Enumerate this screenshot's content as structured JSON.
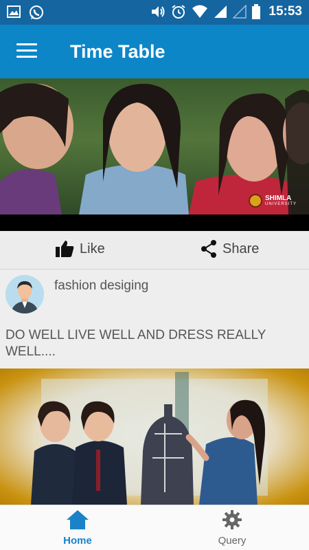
{
  "status_bar": {
    "time": "15:53",
    "icons": [
      "image-icon",
      "whatsapp-icon",
      "volume-icon",
      "alarm-icon",
      "wifi-icon",
      "signal-icon",
      "signal-empty-icon",
      "battery-icon"
    ]
  },
  "app_bar": {
    "title": "Time Table",
    "menu_icon": "hamburger-menu-icon"
  },
  "hero": {
    "logo_name": "SHIMLA",
    "logo_sub": "UNIVERSITY"
  },
  "actions": {
    "like_label": "Like",
    "share_label": "Share"
  },
  "post": {
    "author": "fashion desiging",
    "text": "DO WELL LIVE WELL AND DRESS REALLY WELL...."
  },
  "bottom_nav": {
    "items": [
      {
        "label": "Home",
        "icon": "home-icon",
        "active": true
      },
      {
        "label": "Query",
        "icon": "gear-icon",
        "active": false
      }
    ]
  },
  "colors": {
    "status_bar": "#1565a0",
    "app_bar": "#0d86c8",
    "active_nav": "#1a82c8"
  }
}
